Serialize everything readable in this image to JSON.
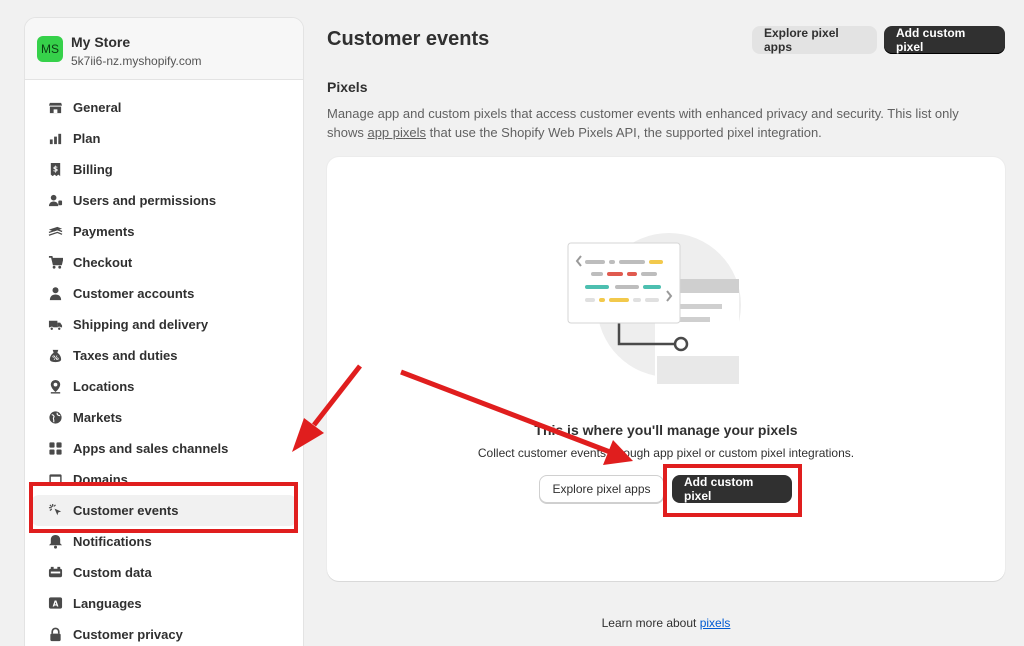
{
  "store": {
    "initials": "MS",
    "name": "My Store",
    "url": "5k7ii6-nz.myshopify.com"
  },
  "sidebar": {
    "items": [
      {
        "label": "General",
        "icon": "store-icon"
      },
      {
        "label": "Plan",
        "icon": "plan-icon"
      },
      {
        "label": "Billing",
        "icon": "billing-icon"
      },
      {
        "label": "Users and permissions",
        "icon": "users-icon"
      },
      {
        "label": "Payments",
        "icon": "payments-icon"
      },
      {
        "label": "Checkout",
        "icon": "cart-icon"
      },
      {
        "label": "Customer accounts",
        "icon": "person-icon"
      },
      {
        "label": "Shipping and delivery",
        "icon": "truck-icon"
      },
      {
        "label": "Taxes and duties",
        "icon": "tax-icon"
      },
      {
        "label": "Locations",
        "icon": "location-icon"
      },
      {
        "label": "Markets",
        "icon": "globe-icon"
      },
      {
        "label": "Apps and sales channels",
        "icon": "apps-icon"
      },
      {
        "label": "Domains",
        "icon": "domain-icon"
      },
      {
        "label": "Customer events",
        "icon": "cursor-click-icon",
        "active": true
      },
      {
        "label": "Notifications",
        "icon": "bell-icon"
      },
      {
        "label": "Custom data",
        "icon": "custom-data-icon"
      },
      {
        "label": "Languages",
        "icon": "language-icon"
      },
      {
        "label": "Customer privacy",
        "icon": "lock-icon"
      }
    ]
  },
  "page": {
    "title": "Customer events",
    "explore_button": "Explore pixel apps",
    "add_button": "Add custom pixel"
  },
  "pixels": {
    "title": "Pixels",
    "desc_before": "Manage app and custom pixels that access customer events with enhanced privacy and security. This list only shows ",
    "desc_link": "app pixels",
    "desc_after": " that use the Shopify Web Pixels API, the supported pixel integration."
  },
  "empty_state": {
    "title": "This is where you'll manage your pixels",
    "description": "Collect customer events through app pixel or custom pixel integrations.",
    "explore_button": "Explore pixel apps",
    "add_button": "Add custom pixel"
  },
  "footer": {
    "text": "Learn more about ",
    "link": "pixels"
  },
  "colors": {
    "accent": "#303030",
    "store_avatar": "#36d14a",
    "link": "#005bd3",
    "annotation": "#e01e1e"
  }
}
